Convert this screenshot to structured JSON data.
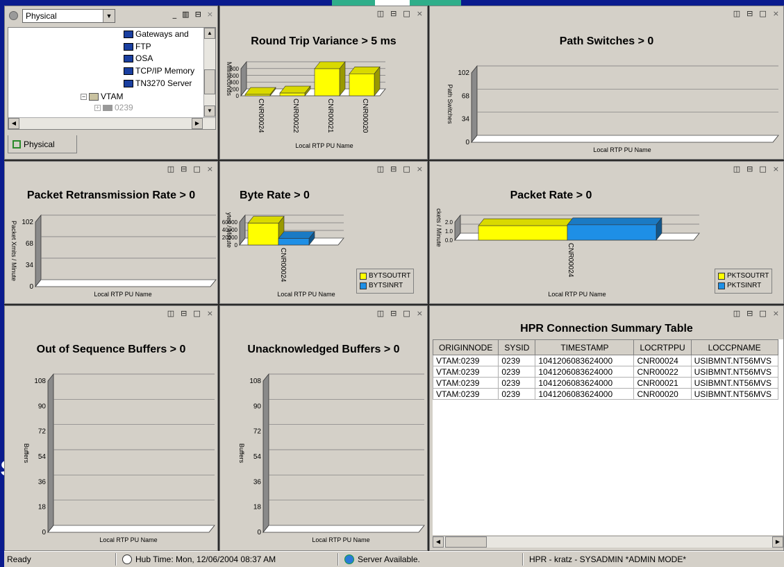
{
  "navigator": {
    "view_select": "Physical",
    "window_ctrls": [
      "_",
      "▥",
      "⊟",
      "×"
    ],
    "tree_items": [
      {
        "label": "Gateways and"
      },
      {
        "label": "FTP"
      },
      {
        "label": "OSA"
      },
      {
        "label": "TCP/IP Memory"
      },
      {
        "label": "TN3270 Server"
      },
      {
        "label": "VTAM"
      },
      {
        "label": "0239"
      }
    ],
    "tab_label": "Physical"
  },
  "pane_ctrls": [
    "◫",
    "⊟",
    "□",
    "×"
  ],
  "charts": {
    "rtt": {
      "title": "Round Trip Variance > 5 ms"
    },
    "path": {
      "title": "Path Switches > 0"
    },
    "prr": {
      "title": "Packet Retransmission Rate > 0"
    },
    "byte": {
      "title": "Byte Rate > 0"
    },
    "pkt": {
      "title": "Packet Rate > 0"
    },
    "oos": {
      "title": "Out of Sequence Buffers > 0"
    },
    "unack": {
      "title": "Unacknowledged Buffers > 0"
    }
  },
  "chart_data": [
    {
      "id": "rtt",
      "type": "bar",
      "title": "Round Trip Variance > 5 ms",
      "xlabel": "Local RTP PU Name",
      "ylabel": "Milliseconds",
      "categories": [
        "CNR00024",
        "CNR00022",
        "CNR00021",
        "CNR00020"
      ],
      "values": [
        40,
        80,
        800,
        650
      ],
      "yticks": [
        "800",
        "600",
        "400",
        "200",
        "0"
      ],
      "colors": [
        "#ffff00"
      ]
    },
    {
      "id": "path",
      "type": "bar",
      "title": "Path Switches > 0",
      "xlabel": "Local RTP PU Name",
      "ylabel": "Path Switches",
      "categories": [],
      "values": [],
      "yticks": [
        "102",
        "68",
        "34",
        "0"
      ],
      "ylim": [
        0,
        102
      ]
    },
    {
      "id": "prr",
      "type": "bar",
      "title": "Packet Retransmission Rate > 0",
      "xlabel": "Local RTP PU Name",
      "ylabel": "Packet Xmits / Minute",
      "categories": [],
      "values": [],
      "yticks": [
        "102",
        "68",
        "34",
        "0"
      ],
      "ylim": [
        0,
        102
      ]
    },
    {
      "id": "byte",
      "type": "bar",
      "title": "Byte Rate > 0",
      "xlabel": "Local RTP PU Name",
      "ylabel": "ytes / Minute",
      "categories": [
        "CNR00024"
      ],
      "series": [
        {
          "name": "BYTSOUTRT",
          "values": [
            57000
          ]
        },
        {
          "name": "BYTSINRT",
          "values": [
            17000
          ]
        }
      ],
      "yticks": [
        "60000",
        "40000",
        "20000",
        "0"
      ]
    },
    {
      "id": "pkt",
      "type": "bar",
      "title": "Packet Rate > 0",
      "xlabel": "Local RTP PU Name",
      "ylabel": "ckets / Minute",
      "categories": [
        "CNR00024"
      ],
      "series": [
        {
          "name": "PKTSOUTRT",
          "values": [
            1.6
          ]
        },
        {
          "name": "PKTSINRT",
          "values": [
            1.7
          ]
        }
      ],
      "yticks": [
        "2.0",
        "1.0",
        "0.0"
      ]
    },
    {
      "id": "oos",
      "type": "bar",
      "title": "Out of Sequence Buffers > 0",
      "xlabel": "Local RTP PU Name",
      "ylabel": "Buffers",
      "categories": [],
      "values": [],
      "yticks": [
        "108",
        "90",
        "72",
        "54",
        "36",
        "18",
        "0"
      ],
      "ylim": [
        0,
        108
      ]
    },
    {
      "id": "unack",
      "type": "bar",
      "title": "Unacknowledged Buffers > 0",
      "xlabel": "Local RTP PU Name",
      "ylabel": "Buffers",
      "categories": [],
      "values": [],
      "yticks": [
        "108",
        "90",
        "72",
        "54",
        "36",
        "18",
        "0"
      ],
      "ylim": [
        0,
        108
      ]
    }
  ],
  "table": {
    "title": "HPR Connection Summary Table",
    "columns": [
      "ORIGINNODE",
      "SYSID",
      "TIMESTAMP",
      "LOCRTPPU",
      "LOCCPNAME"
    ],
    "rows": [
      [
        "VTAM:0239",
        "0239",
        "1041206083624000",
        "CNR00024",
        "USIBMNT.NT56MVS"
      ],
      [
        "VTAM:0239",
        "0239",
        "1041206083624000",
        "CNR00022",
        "USIBMNT.NT56MVS"
      ],
      [
        "VTAM:0239",
        "0239",
        "1041206083624000",
        "CNR00021",
        "USIBMNT.NT56MVS"
      ],
      [
        "VTAM:0239",
        "0239",
        "1041206083624000",
        "CNR00020",
        "USIBMNT.NT56MVS"
      ]
    ]
  },
  "status": {
    "ready": "Ready",
    "hub_time": "Hub Time: Mon, 12/06/2004 08:37 AM",
    "server": "Server Available.",
    "user": "HPR - kratz - SYSADMIN   *ADMIN MODE*"
  },
  "background_letter": "s"
}
